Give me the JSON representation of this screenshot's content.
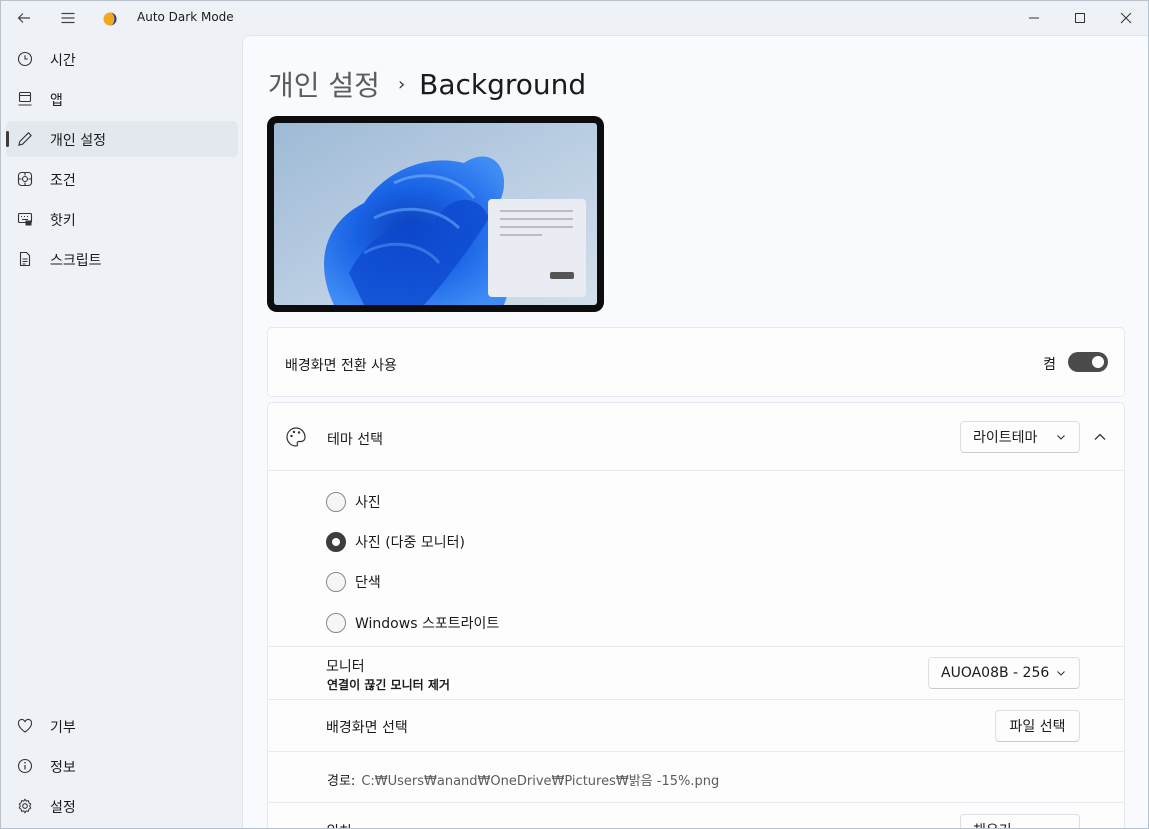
{
  "app": {
    "title": "Auto Dark Mode"
  },
  "sidebar": {
    "items": [
      {
        "label": "시간",
        "icon": "clock-icon"
      },
      {
        "label": "앱",
        "icon": "app-window-icon"
      },
      {
        "label": "개인 설정",
        "icon": "pen-icon",
        "selected": true
      },
      {
        "label": "조건",
        "icon": "conditions-icon"
      },
      {
        "label": "핫키",
        "icon": "keyboard-icon"
      },
      {
        "label": "스크립트",
        "icon": "document-icon"
      }
    ],
    "footer": [
      {
        "label": "기부",
        "icon": "heart-icon"
      },
      {
        "label": "정보",
        "icon": "info-icon"
      },
      {
        "label": "설정",
        "icon": "gear-icon"
      }
    ]
  },
  "breadcrumb": {
    "parent": "개인 설정",
    "separator": "›",
    "current": "Background"
  },
  "toggle_card": {
    "label": "배경화면 전환 사용",
    "state_label": "켬",
    "on": true
  },
  "theme_card": {
    "label": "테마 선택",
    "selected_theme": "라이트테마",
    "expanded": true,
    "radio_options": [
      {
        "label": "사진",
        "checked": false
      },
      {
        "label": "사진 (다중 모니터)",
        "checked": true
      },
      {
        "label": "단색",
        "checked": false
      },
      {
        "label": "Windows 스포트라이트",
        "checked": false
      }
    ],
    "monitor": {
      "title": "모니터",
      "remove_link": "연결이 끊긴 모니터 제거",
      "selected": "AUOA08B - 256"
    },
    "wallpaper": {
      "label": "배경화면 선택",
      "button": "파일 선택"
    },
    "path": {
      "label": "경로:",
      "value": "C:₩Users₩anand₩OneDrive₩Pictures₩밝음 -15%.png"
    },
    "position": {
      "label": "위치",
      "button": "채우기"
    }
  },
  "colors": {
    "accent_dark": "#3d3d3d",
    "toggle_on": "#4b4b4b",
    "wallpaper_blue": "#1e5bd8"
  }
}
